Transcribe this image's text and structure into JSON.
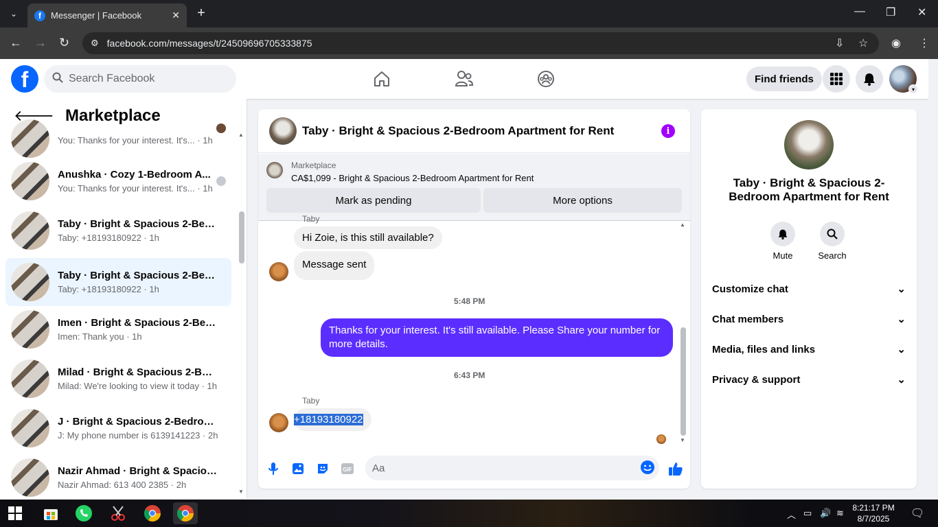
{
  "browser": {
    "tab_title": "Messenger | Facebook",
    "url": "facebook.com/messages/t/24509696705333875"
  },
  "header": {
    "search_placeholder": "Search Facebook",
    "find_friends": "Find friends"
  },
  "left": {
    "title": "Marketplace",
    "conversations": [
      {
        "name": "",
        "snippet": "You: Thanks for your interest. It's... · 1h"
      },
      {
        "name": "Anushka · Cozy 1-Bedroom A...",
        "snippet": "You: Thanks for your interest. It's... · 1h"
      },
      {
        "name": "Taby · Bright & Spacious 2-Bedr...",
        "snippet": "Taby: +18193180922 · 1h"
      },
      {
        "name": "Taby · Bright & Spacious 2-Bedr...",
        "snippet": "Taby: +18193180922 · 1h"
      },
      {
        "name": "Imen · Bright & Spacious 2-Bedr...",
        "snippet": "Imen: Thank you · 1h"
      },
      {
        "name": "Milad · Bright & Spacious 2-Bed...",
        "snippet": "Milad: We're looking to view it today · 1h"
      },
      {
        "name": "J · Bright & Spacious 2-Bedroom...",
        "snippet": "J: My phone number is 6139141223 · 2h"
      },
      {
        "name": "Nazir Ahmad · Bright & Spaciou...",
        "snippet": "Nazir Ahmad: 613 400 2385 · 2h"
      }
    ]
  },
  "chat": {
    "title": "Taby · Bright & Spacious 2-Bedroom Apartment for Rent",
    "marketplace_label": "Marketplace",
    "listing": "CA$1,099 - Bright & Spacious 2-Bedroom Apartment for Rent",
    "mark_pending": "Mark as pending",
    "more_options": "More options",
    "sender_top": "Taby",
    "msg1": "Hi Zoie, is this still available?",
    "msg2": "Message sent",
    "time1": "5:48 PM",
    "out_msg": "Thanks for your interest.  It's still available. Please Share your number for more details.",
    "time2": "6:43 PM",
    "sender": "Taby",
    "phone_msg": "+18193180922",
    "input_placeholder": "Aa"
  },
  "right": {
    "name": "Taby · Bright & Spacious 2-Bedroom Apartment for Rent",
    "mute": "Mute",
    "search": "Search",
    "items": [
      "Customize chat",
      "Chat members",
      "Media, files and links",
      "Privacy & support"
    ]
  },
  "taskbar": {
    "time": "8:21:17 PM",
    "date": "8/7/2025"
  },
  "colors": {
    "brand": "#0866ff",
    "outgoing_bubble": "#5b2eff",
    "info_icon": "#a100ff"
  }
}
